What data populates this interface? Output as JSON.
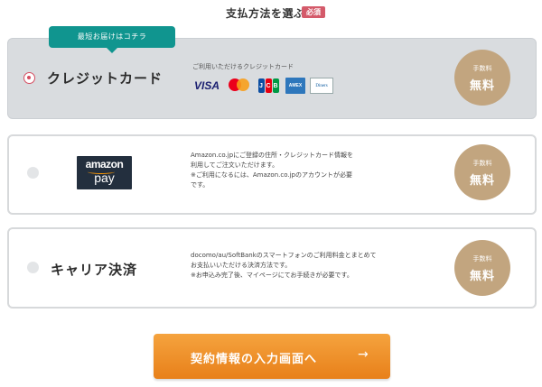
{
  "section": {
    "title": "支払方法を選ぶ",
    "required_badge": "必須"
  },
  "methods": [
    {
      "tag": "最短お届けはコチラ",
      "label": "クレジットカード",
      "subtitle": "ご利用いただけるクレジットカード",
      "brands": [
        "VISA",
        "mastercard",
        "JCB",
        "AMERICAN EXPRESS",
        "Diners Club"
      ],
      "fee_small": "手数料",
      "fee_big": "無料",
      "selected": true
    },
    {
      "logo_top": "amazon",
      "logo_bottom": "pay",
      "desc": [
        "Amazon.co.jpにご登録の住所・クレジットカード情報を",
        "利用してご注文いただけます。",
        "※ご利用になるには、Amazon.co.jpのアカウントが必要",
        "です。"
      ],
      "fee_small": "手数料",
      "fee_big": "無料",
      "selected": false
    },
    {
      "label": "キャリア決済",
      "desc": [
        "docomo/au/SoftBankのスマートフォンのご利用料金とまとめて",
        "お支払いいただける決済方法です。",
        "※お申込み完了後、マイページにてお手続きが必要です。"
      ],
      "fee_small": "手数料",
      "fee_big": "無料",
      "selected": false
    }
  ],
  "cta": {
    "label": "契約情報の入力画面へ",
    "arrow": "→"
  },
  "colors": {
    "accent_teal": "#10958f",
    "fee_badge": "#c2a57f",
    "cta_orange": "#ee8f27",
    "required_red": "#d45a6a"
  }
}
